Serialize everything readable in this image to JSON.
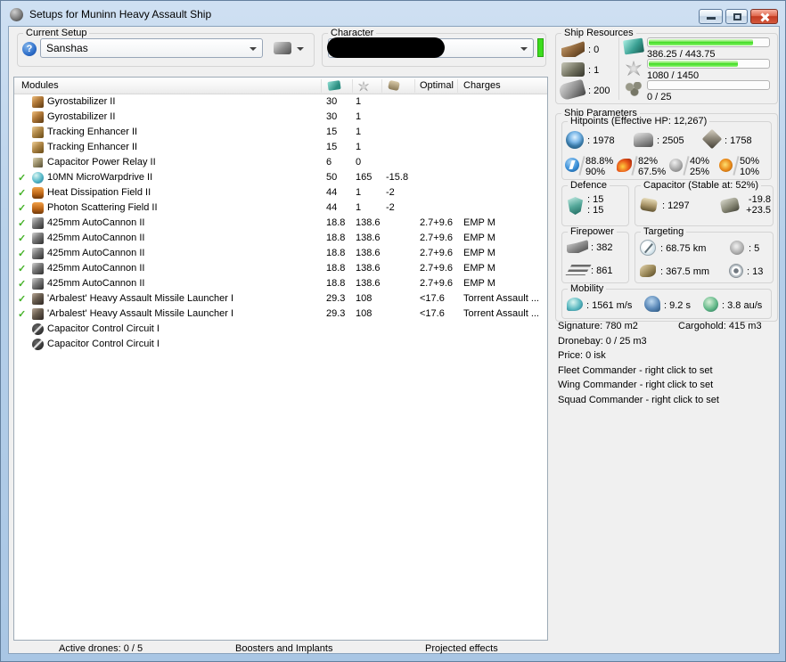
{
  "window": {
    "title": "Setups for Muninn Heavy Assault Ship"
  },
  "setup": {
    "label": "Current Setup",
    "value": "Sanshas",
    "help_glyph": "?"
  },
  "character": {
    "label": "Character",
    "value": "",
    "redacted": true
  },
  "icons": {
    "titlebar": [
      "app-icon",
      "minimize-icon",
      "maximize-icon",
      "close-icon"
    ],
    "columns": [
      "cpu-icon",
      "powergrid-icon",
      "capacitor-icon"
    ],
    "resources": [
      "turret-slot-icon",
      "launcher-slot-icon",
      "calibration-icon",
      "cpu-icon",
      "powergrid-icon",
      "drones-icon"
    ],
    "hitpoints": [
      "shield-hp-icon",
      "armor-hp-icon",
      "structure-hp-icon",
      "em-resist-icon",
      "thermal-resist-icon",
      "kinetic-resist-icon",
      "explosive-resist-icon"
    ],
    "panels": [
      "defence-shield-icon",
      "capacitor-amount-icon",
      "capacitor-delta-icon",
      "firepower-turret-icon",
      "dps-icon",
      "targeting-range-icon",
      "max-targets-icon",
      "scan-resolution-icon",
      "signature-resolution-icon",
      "speed-icon",
      "align-time-icon",
      "warp-speed-icon"
    ]
  },
  "modules": {
    "header": {
      "name": "Modules",
      "optimal": "Optimal",
      "charges": "Charges"
    },
    "rows": [
      {
        "check": "",
        "icon": "gyro",
        "name": "Gyrostabilizer II",
        "cpu": "30",
        "pg": "1",
        "cap": "",
        "optimal": "",
        "charges": ""
      },
      {
        "check": "",
        "icon": "gyro",
        "name": "Gyrostabilizer II",
        "cpu": "30",
        "pg": "1",
        "cap": "",
        "optimal": "",
        "charges": ""
      },
      {
        "check": "",
        "icon": "te",
        "name": "Tracking Enhancer II",
        "cpu": "15",
        "pg": "1",
        "cap": "",
        "optimal": "",
        "charges": ""
      },
      {
        "check": "",
        "icon": "te",
        "name": "Tracking Enhancer II",
        "cpu": "15",
        "pg": "1",
        "cap": "",
        "optimal": "",
        "charges": ""
      },
      {
        "check": "",
        "icon": "relay",
        "name": "Capacitor Power Relay II",
        "cpu": "6",
        "pg": "0",
        "cap": "",
        "optimal": "",
        "charges": ""
      },
      {
        "check": "✓",
        "icon": "mwd",
        "name": "10MN MicroWarpdrive II",
        "cpu": "50",
        "pg": "165",
        "cap": "-15.8",
        "optimal": "",
        "charges": ""
      },
      {
        "check": "✓",
        "icon": "hardener",
        "name": "Heat Dissipation Field II",
        "cpu": "44",
        "pg": "1",
        "cap": "-2",
        "optimal": "",
        "charges": ""
      },
      {
        "check": "✓",
        "icon": "hardener",
        "name": "Photon Scattering Field II",
        "cpu": "44",
        "pg": "1",
        "cap": "-2",
        "optimal": "",
        "charges": ""
      },
      {
        "check": "✓",
        "icon": "autocannon",
        "name": "425mm AutoCannon II",
        "cpu": "18.8",
        "pg": "138.6",
        "cap": "",
        "optimal": "2.7+9.6",
        "charges": "EMP M"
      },
      {
        "check": "✓",
        "icon": "autocannon",
        "name": "425mm AutoCannon II",
        "cpu": "18.8",
        "pg": "138.6",
        "cap": "",
        "optimal": "2.7+9.6",
        "charges": "EMP M"
      },
      {
        "check": "✓",
        "icon": "autocannon",
        "name": "425mm AutoCannon II",
        "cpu": "18.8",
        "pg": "138.6",
        "cap": "",
        "optimal": "2.7+9.6",
        "charges": "EMP M"
      },
      {
        "check": "✓",
        "icon": "autocannon",
        "name": "425mm AutoCannon II",
        "cpu": "18.8",
        "pg": "138.6",
        "cap": "",
        "optimal": "2.7+9.6",
        "charges": "EMP M"
      },
      {
        "check": "✓",
        "icon": "autocannon",
        "name": "425mm AutoCannon II",
        "cpu": "18.8",
        "pg": "138.6",
        "cap": "",
        "optimal": "2.7+9.6",
        "charges": "EMP M"
      },
      {
        "check": "✓",
        "icon": "launcher",
        "name": "'Arbalest' Heavy Assault Missile Launcher I",
        "cpu": "29.3",
        "pg": "108",
        "cap": "",
        "optimal": "<17.6",
        "charges": "Torrent Assault ..."
      },
      {
        "check": "✓",
        "icon": "launcher",
        "name": "'Arbalest' Heavy Assault Missile Launcher I",
        "cpu": "29.3",
        "pg": "108",
        "cap": "",
        "optimal": "<17.6",
        "charges": "Torrent Assault ..."
      },
      {
        "check": "",
        "icon": "rig",
        "name": "Capacitor Control Circuit I",
        "cpu": "",
        "pg": "",
        "cap": "",
        "optimal": "",
        "charges": ""
      },
      {
        "check": "",
        "icon": "rig",
        "name": "Capacitor Control Circuit I",
        "cpu": "",
        "pg": "",
        "cap": "",
        "optimal": "",
        "charges": ""
      }
    ]
  },
  "ship_resources": {
    "label": "Ship Resources",
    "slots": [
      {
        "icon": "turret-slot",
        "value": ": 0"
      },
      {
        "icon": "launcher-slot",
        "value": ": 1"
      },
      {
        "icon": "calibration",
        "value": ": 200"
      }
    ],
    "bars": [
      {
        "icon": "cpu",
        "label": "386.25 / 443.75",
        "pct": 87
      },
      {
        "icon": "powergrid",
        "label": "1080 / 1450",
        "pct": 74.5
      },
      {
        "icon": "drones",
        "label": "0 / 25",
        "pct": 0
      }
    ]
  },
  "ship_parameters": {
    "label": "Ship Parameters",
    "hitpoints": {
      "label": "Hitpoints (Effective HP: 12,267)",
      "shield": ": 1978",
      "armor": ": 2505",
      "structure": ": 1758",
      "resists": [
        {
          "type": "em",
          "top": "88.8%",
          "bottom": "90%"
        },
        {
          "type": "thermal",
          "top": "82%",
          "bottom": "67.5%"
        },
        {
          "type": "kinetic",
          "top": "40%",
          "bottom": "25%"
        },
        {
          "type": "explosive",
          "top": "50%",
          "bottom": "10%"
        }
      ]
    },
    "defence": {
      "label": "Defence",
      "top": ": 15",
      "bottom": ": 15"
    },
    "capacitor": {
      "label": "Capacitor (Stable at: 52%)",
      "amount": ": 1297",
      "delta_top": "-19.8",
      "delta_bottom": "+23.5"
    },
    "firepower": {
      "label": "Firepower",
      "volley": ": 382",
      "dps": ": 861"
    },
    "targeting": {
      "label": "Targeting",
      "range": ": 68.75 km",
      "max_targets": ": 5",
      "scan_res": ": 367.5 mm",
      "sig_resolution": ": 13"
    },
    "mobility": {
      "label": "Mobility",
      "speed": ": 1561 m/s",
      "align": ": 9.2 s",
      "warp": ": 3.8 au/s"
    }
  },
  "info": {
    "signature": "Signature: 780 m2",
    "cargohold": "Cargohold: 415 m3",
    "dronebay": "Dronebay: 0 / 25 m3",
    "price": "Price: 0 isk",
    "fleet": "Fleet Commander - right click to set",
    "wing": "Wing Commander - right click to set",
    "squad": "Squad Commander - right click to set"
  },
  "bottom": {
    "active_drones": "Active drones: 0 / 5",
    "boosters": "Boosters and Implants",
    "projected": "Projected effects"
  },
  "colors": {
    "accent_green": "#3ddd1e",
    "check_green": "#44b227",
    "close_red": "#c33b22"
  }
}
